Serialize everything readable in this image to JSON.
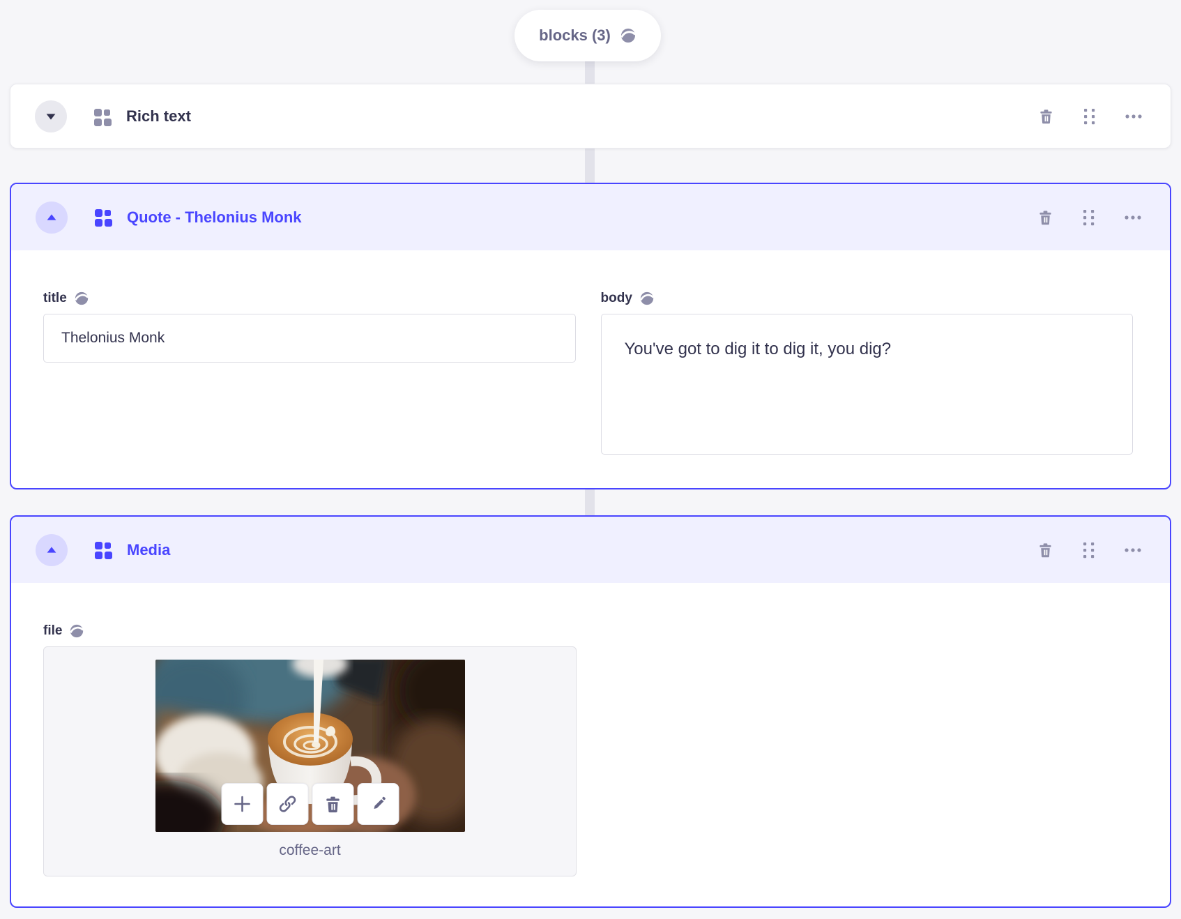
{
  "pill": {
    "label": "blocks (3)"
  },
  "blocks": [
    {
      "title": "Rich text",
      "state": "collapsed"
    },
    {
      "title": "Quote - Thelonius Monk",
      "state": "expanded",
      "fields": {
        "title": {
          "label": "title",
          "value": "Thelonius Monk"
        },
        "body": {
          "label": "body",
          "value": "You've got to dig it to dig it, you dig?"
        }
      }
    },
    {
      "title": "Media",
      "state": "expanded",
      "fields": {
        "file": {
          "label": "file",
          "file_name": "coffee-art"
        }
      }
    }
  ],
  "icons": {
    "pill_globe": "globe-icon",
    "field_globe": "globe-icon",
    "block": "component-grid-icon",
    "collapsed_toggle": "chevron-down-icon",
    "expanded_toggle": "chevron-up-icon",
    "header_actions": [
      "trash-icon",
      "drag-handle-icon",
      "more-horizontal-icon"
    ],
    "media_actions": [
      "plus-icon",
      "link-icon",
      "trash-icon",
      "pencil-icon"
    ]
  },
  "colors": {
    "page_bg": "#f6f6f9",
    "accent": "#4945ff",
    "accent_header_bg": "#f0f0ff",
    "accent_toggle_bg": "#d9d8ff",
    "neutral_toggle_bg": "#e9e9ef",
    "icon_gray": "#8e8ea9",
    "text_dark": "#32324d",
    "text_secondary": "#666687",
    "input_border": "#dcdce4",
    "connector": "#e2e2ea"
  }
}
